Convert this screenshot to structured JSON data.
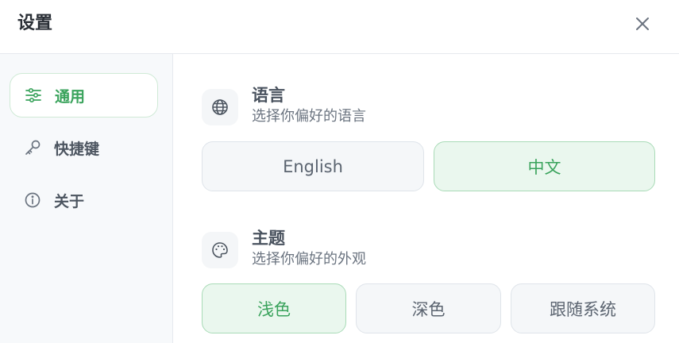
{
  "window": {
    "title": "设置"
  },
  "sidebar": {
    "items": [
      {
        "label": "通用",
        "icon": "sliders-icon",
        "active": true
      },
      {
        "label": "快捷键",
        "icon": "key-icon",
        "active": false
      },
      {
        "label": "关于",
        "icon": "info-icon",
        "active": false
      }
    ]
  },
  "language": {
    "title": "语言",
    "description": "选择你偏好的语言",
    "icon": "globe-icon",
    "options": [
      {
        "label": "English",
        "selected": false
      },
      {
        "label": "中文",
        "selected": true
      }
    ]
  },
  "theme": {
    "title": "主题",
    "description": "选择你偏好的外观",
    "icon": "palette-icon",
    "options": [
      {
        "label": "浅色",
        "selected": true
      },
      {
        "label": "深色",
        "selected": false
      },
      {
        "label": "跟随系统",
        "selected": false
      }
    ]
  },
  "colors": {
    "accent": "#3aa35c",
    "accent_bg": "#eaf7ee",
    "accent_border": "#a9dbb7",
    "sidebar_bg": "#f7f9fb"
  }
}
